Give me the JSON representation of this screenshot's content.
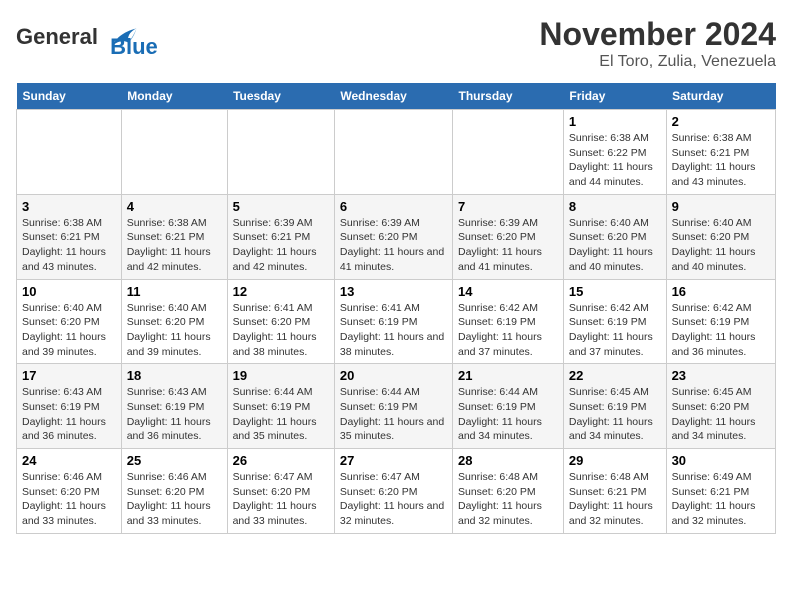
{
  "logo": {
    "line1": "General",
    "line2": "Blue"
  },
  "title": "November 2024",
  "subtitle": "El Toro, Zulia, Venezuela",
  "days_of_week": [
    "Sunday",
    "Monday",
    "Tuesday",
    "Wednesday",
    "Thursday",
    "Friday",
    "Saturday"
  ],
  "weeks": [
    [
      {
        "num": "",
        "info": ""
      },
      {
        "num": "",
        "info": ""
      },
      {
        "num": "",
        "info": ""
      },
      {
        "num": "",
        "info": ""
      },
      {
        "num": "",
        "info": ""
      },
      {
        "num": "1",
        "info": "Sunrise: 6:38 AM\nSunset: 6:22 PM\nDaylight: 11 hours and 44 minutes."
      },
      {
        "num": "2",
        "info": "Sunrise: 6:38 AM\nSunset: 6:21 PM\nDaylight: 11 hours and 43 minutes."
      }
    ],
    [
      {
        "num": "3",
        "info": "Sunrise: 6:38 AM\nSunset: 6:21 PM\nDaylight: 11 hours and 43 minutes."
      },
      {
        "num": "4",
        "info": "Sunrise: 6:38 AM\nSunset: 6:21 PM\nDaylight: 11 hours and 42 minutes."
      },
      {
        "num": "5",
        "info": "Sunrise: 6:39 AM\nSunset: 6:21 PM\nDaylight: 11 hours and 42 minutes."
      },
      {
        "num": "6",
        "info": "Sunrise: 6:39 AM\nSunset: 6:20 PM\nDaylight: 11 hours and 41 minutes."
      },
      {
        "num": "7",
        "info": "Sunrise: 6:39 AM\nSunset: 6:20 PM\nDaylight: 11 hours and 41 minutes."
      },
      {
        "num": "8",
        "info": "Sunrise: 6:40 AM\nSunset: 6:20 PM\nDaylight: 11 hours and 40 minutes."
      },
      {
        "num": "9",
        "info": "Sunrise: 6:40 AM\nSunset: 6:20 PM\nDaylight: 11 hours and 40 minutes."
      }
    ],
    [
      {
        "num": "10",
        "info": "Sunrise: 6:40 AM\nSunset: 6:20 PM\nDaylight: 11 hours and 39 minutes."
      },
      {
        "num": "11",
        "info": "Sunrise: 6:40 AM\nSunset: 6:20 PM\nDaylight: 11 hours and 39 minutes."
      },
      {
        "num": "12",
        "info": "Sunrise: 6:41 AM\nSunset: 6:20 PM\nDaylight: 11 hours and 38 minutes."
      },
      {
        "num": "13",
        "info": "Sunrise: 6:41 AM\nSunset: 6:19 PM\nDaylight: 11 hours and 38 minutes."
      },
      {
        "num": "14",
        "info": "Sunrise: 6:42 AM\nSunset: 6:19 PM\nDaylight: 11 hours and 37 minutes."
      },
      {
        "num": "15",
        "info": "Sunrise: 6:42 AM\nSunset: 6:19 PM\nDaylight: 11 hours and 37 minutes."
      },
      {
        "num": "16",
        "info": "Sunrise: 6:42 AM\nSunset: 6:19 PM\nDaylight: 11 hours and 36 minutes."
      }
    ],
    [
      {
        "num": "17",
        "info": "Sunrise: 6:43 AM\nSunset: 6:19 PM\nDaylight: 11 hours and 36 minutes."
      },
      {
        "num": "18",
        "info": "Sunrise: 6:43 AM\nSunset: 6:19 PM\nDaylight: 11 hours and 36 minutes."
      },
      {
        "num": "19",
        "info": "Sunrise: 6:44 AM\nSunset: 6:19 PM\nDaylight: 11 hours and 35 minutes."
      },
      {
        "num": "20",
        "info": "Sunrise: 6:44 AM\nSunset: 6:19 PM\nDaylight: 11 hours and 35 minutes."
      },
      {
        "num": "21",
        "info": "Sunrise: 6:44 AM\nSunset: 6:19 PM\nDaylight: 11 hours and 34 minutes."
      },
      {
        "num": "22",
        "info": "Sunrise: 6:45 AM\nSunset: 6:19 PM\nDaylight: 11 hours and 34 minutes."
      },
      {
        "num": "23",
        "info": "Sunrise: 6:45 AM\nSunset: 6:20 PM\nDaylight: 11 hours and 34 minutes."
      }
    ],
    [
      {
        "num": "24",
        "info": "Sunrise: 6:46 AM\nSunset: 6:20 PM\nDaylight: 11 hours and 33 minutes."
      },
      {
        "num": "25",
        "info": "Sunrise: 6:46 AM\nSunset: 6:20 PM\nDaylight: 11 hours and 33 minutes."
      },
      {
        "num": "26",
        "info": "Sunrise: 6:47 AM\nSunset: 6:20 PM\nDaylight: 11 hours and 33 minutes."
      },
      {
        "num": "27",
        "info": "Sunrise: 6:47 AM\nSunset: 6:20 PM\nDaylight: 11 hours and 32 minutes."
      },
      {
        "num": "28",
        "info": "Sunrise: 6:48 AM\nSunset: 6:20 PM\nDaylight: 11 hours and 32 minutes."
      },
      {
        "num": "29",
        "info": "Sunrise: 6:48 AM\nSunset: 6:21 PM\nDaylight: 11 hours and 32 minutes."
      },
      {
        "num": "30",
        "info": "Sunrise: 6:49 AM\nSunset: 6:21 PM\nDaylight: 11 hours and 32 minutes."
      }
    ]
  ]
}
